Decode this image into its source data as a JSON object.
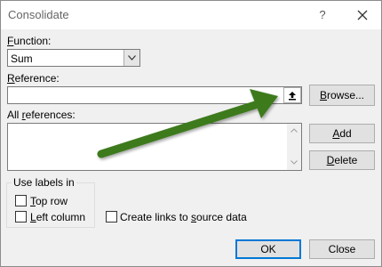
{
  "window": {
    "title": "Consolidate",
    "help_glyph": "?",
    "close_icon": "close-icon"
  },
  "function": {
    "label_key": "F",
    "label_rest": "unction:",
    "selected": "Sum"
  },
  "reference": {
    "label_key": "R",
    "label_rest": "eference:",
    "value": "",
    "collapse_icon": "upload-arrow-icon",
    "browse_label_key": "B",
    "browse_label_rest": "rowse..."
  },
  "all_references": {
    "label_pre": "All ",
    "label_key": "r",
    "label_rest": "eferences:",
    "items": []
  },
  "buttons": {
    "add_key": "A",
    "add_rest": "dd",
    "delete_key": "D",
    "delete_rest": "elete",
    "ok": "OK",
    "close": "Close"
  },
  "use_labels": {
    "title": "Use labels in",
    "top_row_key": "T",
    "top_row_rest": "op row",
    "left_column_key": "L",
    "left_column_rest": "eft column",
    "top_row_checked": false,
    "left_column_checked": false
  },
  "create_links": {
    "label_pre": "Create links to ",
    "label_key": "s",
    "label_rest": "ource data",
    "checked": false
  },
  "annotation": {
    "arrow_color": "#3d7a1f"
  }
}
